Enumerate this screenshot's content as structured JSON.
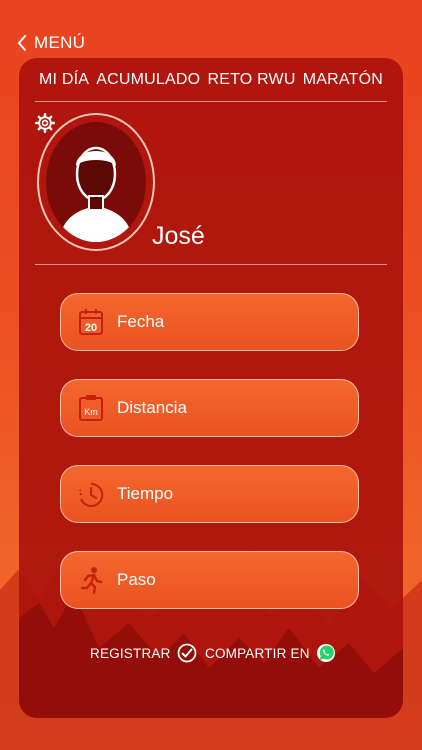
{
  "header": {
    "back_label": "MENÚ"
  },
  "tabs": [
    {
      "label": "MI DÍA"
    },
    {
      "label": "ACUMULADO"
    },
    {
      "label": "RETO RWU"
    },
    {
      "label": "MARATÓN"
    }
  ],
  "profile": {
    "name": "José"
  },
  "fields": [
    {
      "label": "Fecha",
      "icon": "calendar-icon",
      "icon_text": "20"
    },
    {
      "label": "Distancia",
      "icon": "distance-clipboard-icon",
      "icon_text": "Km"
    },
    {
      "label": "Tiempo",
      "icon": "timer-icon"
    },
    {
      "label": "Paso",
      "icon": "runner-icon"
    }
  ],
  "footer": {
    "register_label": "REGISTRAR",
    "share_label": "COMPARTIR EN"
  },
  "colors": {
    "background": "#ec4e22",
    "card": "#aa120c",
    "field": "#f06028",
    "accent_icon": "#c8200f"
  }
}
